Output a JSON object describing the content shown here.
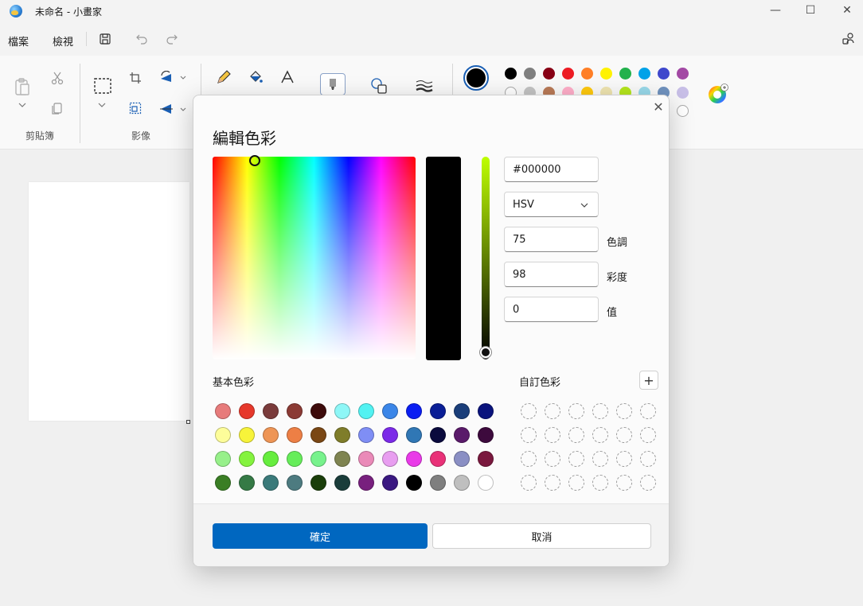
{
  "window": {
    "title": "未命名 - 小畫家",
    "minimize_glyph": "—",
    "maximize_glyph": "☐",
    "close_glyph": "✕"
  },
  "menu": {
    "file": "檔案",
    "view": "檢視"
  },
  "ribbon": {
    "clipboard_label": "剪貼簿",
    "image_label": "影像",
    "current_color": "#000000",
    "palette_row1": [
      "#000000",
      "#7f7f7f",
      "#880015",
      "#ed1c24",
      "#ff7f27",
      "#fff200",
      "#22b14c",
      "#00a2e8",
      "#3f48cc",
      "#a349a4"
    ],
    "palette_row2": [
      "#ffffff",
      "#c3c3c3",
      "#b97a57",
      "#ffaec9",
      "#ffc90e",
      "#efe4b0",
      "#b5e61d",
      "#99d9ea",
      "#7092be",
      "#c8bfe7"
    ]
  },
  "dialog": {
    "title": "編輯色彩",
    "close_glyph": "✕",
    "hex_value": "#000000",
    "mode_value": "HSV",
    "hue_value": "75",
    "hue_label": "色調",
    "saturation_value": "98",
    "saturation_label": "彩度",
    "value_value": "0",
    "value_label": "值",
    "basic_colors_label": "基本色彩",
    "custom_colors_label": "自訂色彩",
    "add_glyph": "+",
    "ok_label": "確定",
    "cancel_label": "取消",
    "basic_colors": [
      [
        "#e77b7b",
        "#e6382b",
        "#7a3b3b",
        "#8b3a34",
        "#3d0b0b",
        "#8ef7f7",
        "#52f2f2",
        "#3b86e8",
        "#0a1ef2",
        "#0a1e96",
        "#1a3e7a",
        "#0a137d"
      ],
      [
        "#fdfd9a",
        "#f7f33a",
        "#ee9555",
        "#ed7f45",
        "#7a4714",
        "#7f7d2a",
        "#7f8ef5",
        "#7b2ae8",
        "#3077b5",
        "#0a0a3d",
        "#5a1a6a",
        "#3d0a3d"
      ],
      [
        "#97f08a",
        "#84f33e",
        "#66ed3e",
        "#66ed5a",
        "#77f28c",
        "#7f8451",
        "#ea8ab8",
        "#e89ef0",
        "#e93ae8",
        "#e93178",
        "#8a8fc4",
        "#7a183e"
      ],
      [
        "#3a7e24",
        "#357a45",
        "#3a7a7a",
        "#4d7b80",
        "#1a3e0a",
        "#1a3d3a",
        "#78207e",
        "#3a1881",
        "#000000",
        "#7f7f7f",
        "#bfbfbf",
        "#ffffff"
      ]
    ]
  }
}
